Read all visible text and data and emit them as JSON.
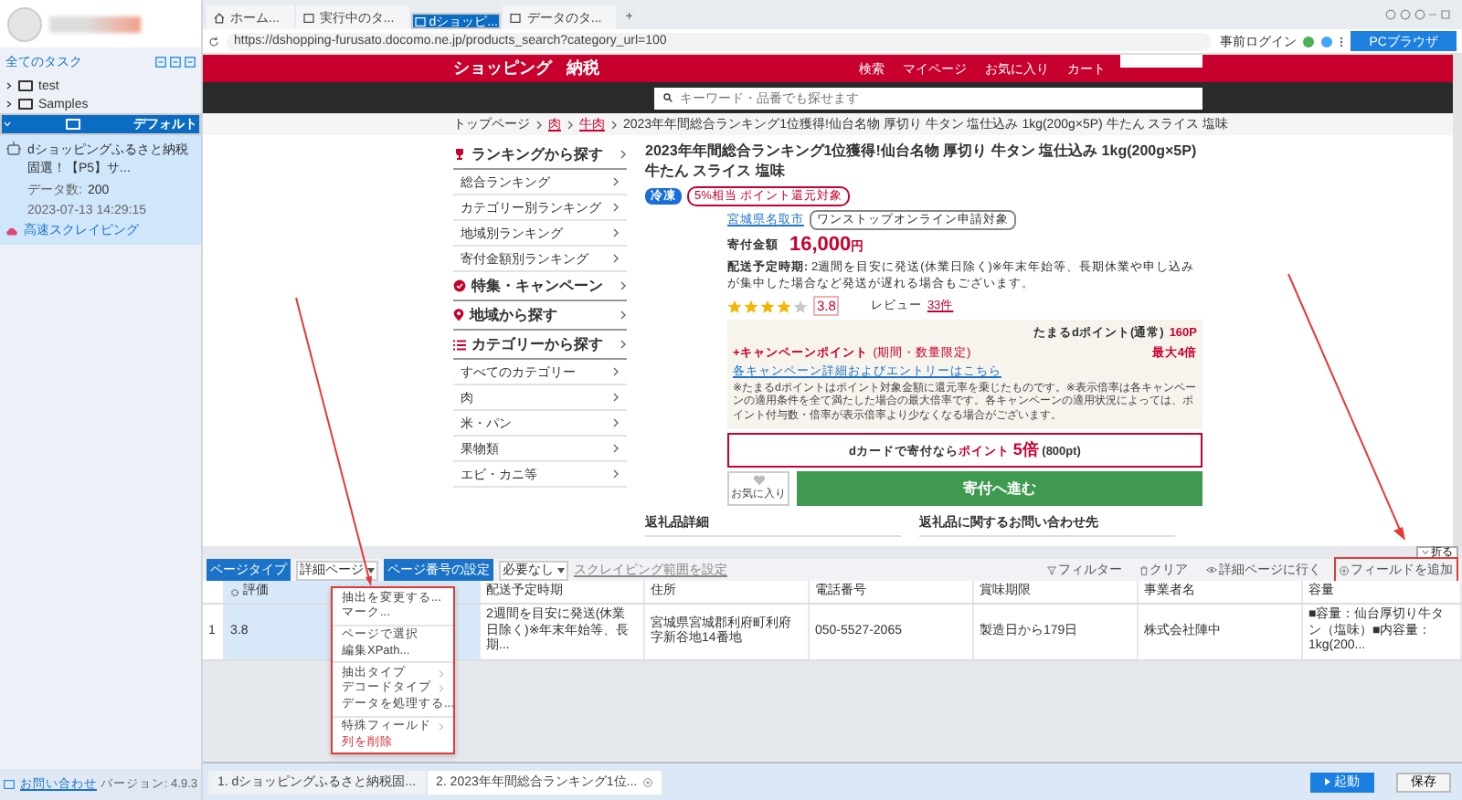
{
  "sidebar": {
    "all_tasks": "全てのタスク",
    "folders": [
      {
        "label": "test",
        "expanded": false,
        "selected": false
      },
      {
        "label": "Samples",
        "expanded": false,
        "selected": false
      },
      {
        "label": "デフォルト",
        "expanded": true,
        "selected": true
      }
    ],
    "task": {
      "title": "dショッピングふるさと納税固選！【P5】サ...",
      "count_label": "データ数:",
      "count": "200",
      "time": "2023-07-13 14:29:15",
      "mode": "高速スクレイピング"
    },
    "contact": "お問い合わせ",
    "version": "バージョン: 4.9.3"
  },
  "browser": {
    "tabs": [
      {
        "label": "ホーム...",
        "kind": "home",
        "selected": false
      },
      {
        "label": "実行中のタ...",
        "kind": "page",
        "selected": false
      },
      {
        "label": "dショッピ...",
        "kind": "page",
        "selected": true
      },
      {
        "label": "データのタ...",
        "kind": "page",
        "selected": false
      }
    ],
    "new_tab": "+",
    "url": "https://dshopping-furusato.docomo.ne.jp/products_search?category_url=100",
    "prelogin": "事前ログイン",
    "pc_browser": "PCブラウザ"
  },
  "page": {
    "logo": "ショッピング",
    "logo_sub": "納税",
    "nav": [
      "検索",
      "マイページ",
      "お気に入り",
      "カート"
    ],
    "search_placeholder": "キーワード・品番でも探せます",
    "breadcrumb": [
      "トップページ",
      "肉",
      "牛肉",
      "2023年年間総合ランキング1位獲得!仙台名物 厚切り 牛タン 塩仕込み 1kg(200g×5P) 牛たん スライス 塩味"
    ],
    "side_sections": [
      {
        "title": "ランキングから探す",
        "kind": "ranking",
        "items": [
          "総合ランキング",
          "カテゴリー別ランキング",
          "地域別ランキング",
          "寄付金額別ランキング"
        ]
      },
      {
        "title": "特集・キャンペーン",
        "kind": "campaign"
      },
      {
        "title": "地域から探す",
        "kind": "region"
      },
      {
        "title": "カテゴリーから探す",
        "kind": "category",
        "items": [
          "すべてのカテゴリー",
          "肉",
          "米・パン",
          "果物類",
          "エビ・カニ等"
        ]
      }
    ],
    "product": {
      "title": "2023年年間総合ランキング1位獲得!仙台名物 厚切り 牛タン 塩仕込み 1kg(200g×5P) 牛たん スライス 塩味",
      "badge": "冷凍",
      "tag": "5%相当 ポイント還元対象",
      "city": "宮城県名取市",
      "onestop": "ワンストップオンライン申請対象",
      "price_label": "寄付金額",
      "price": "16,000",
      "price_unit": "円",
      "delivery_label": "配送予定時期:",
      "delivery": "2週間を目安に発送(休業日除く)※年末年始等、長期休業や申し込みが集中した場合など発送が遅れる場合もございます。",
      "stars": 4,
      "rating": "3.8",
      "review_label": "レビュー",
      "review_count": "33件",
      "points_label": "たまるdポイント(通常)",
      "points": "160P",
      "campaign": "+キャンペーンポイント",
      "campaign_note": "(期間・数量限定)",
      "campaign_max": "最大4倍",
      "campaign_link": "各キャンペーン詳細およびエントリーはこちら",
      "notes": "※たまるdポイントはポイント対象金額に還元率を乗じたものです。※表示倍率は各キャンペーンの適用条件を全て満たした場合の最大倍率です。各キャンペーンの適用状況によっては、ポイント付与数・倍率が表示倍率より少なくなる場合がございます。",
      "dcard": "dカードで寄付なら",
      "dcard_points": "ポイント",
      "dcard_mult": "5倍",
      "dcard_pt": "(800pt)",
      "favorite": "お気に入り",
      "donate": "寄付へ進む"
    },
    "sections": [
      "返礼品詳細",
      "返礼品に関するお問い合わせ先"
    ]
  },
  "collapse": "折る",
  "panel": {
    "page_type_label": "ページタイプ",
    "page_type": "詳細ページ",
    "page_number_label": "ページ番号の設定",
    "page_number": "必要なし",
    "range": "スクレイピング範囲を設定",
    "tools": [
      {
        "label": "フィルター",
        "kind": "filter",
        "highlighted": false
      },
      {
        "label": "クリア",
        "kind": "trash",
        "highlighted": false
      },
      {
        "label": "詳細ページに行く",
        "kind": "eye",
        "highlighted": false
      },
      {
        "label": "フィールドを追加",
        "kind": "add",
        "highlighted": true
      }
    ],
    "columns": [
      {
        "label": "評価",
        "selected": true
      },
      {
        "label": "配送予定時期",
        "selected": false
      },
      {
        "label": "住所",
        "selected": false
      },
      {
        "label": "電話番号",
        "selected": false
      },
      {
        "label": "賞味期限",
        "selected": false
      },
      {
        "label": "事業者名",
        "selected": false
      },
      {
        "label": "容量",
        "selected": false
      }
    ],
    "rows": [
      {
        "number": "1",
        "cells": [
          "3.8",
          "2週間を目安に発送(休業日除く)※年末年始等、長期...",
          "宮城県宮城郡利府町利府字新谷地14番地",
          "050-5527-2065",
          "製造日から179日",
          "株式会社陣中",
          "■容量：仙台厚切り牛タン（塩味）■内容量：1kg(200..."
        ]
      }
    ]
  },
  "menu": {
    "groups": [
      [
        {
          "label": "抽出を変更する...",
          "kind": "action"
        },
        {
          "label": "マーク...",
          "kind": "action"
        }
      ],
      [
        {
          "label": "ページで選択",
          "kind": "action"
        },
        {
          "label": "編集XPath...",
          "kind": "action"
        }
      ],
      [
        {
          "label": "抽出タイプ",
          "kind": "submenu"
        },
        {
          "label": "デコードタイプ",
          "kind": "submenu"
        },
        {
          "label": "データを処理する...",
          "kind": "action"
        }
      ],
      [
        {
          "label": "特殊フィールド",
          "kind": "submenu"
        },
        {
          "label": "列を削除",
          "kind": "danger"
        }
      ]
    ]
  },
  "task_tabs": [
    {
      "label": "1. dショッピングふるさと納税固...",
      "selected": false
    },
    {
      "label": "2. 2023年年間総合ランキング1位...",
      "selected": true
    }
  ],
  "footer": {
    "start": "起動",
    "save": "保存"
  }
}
